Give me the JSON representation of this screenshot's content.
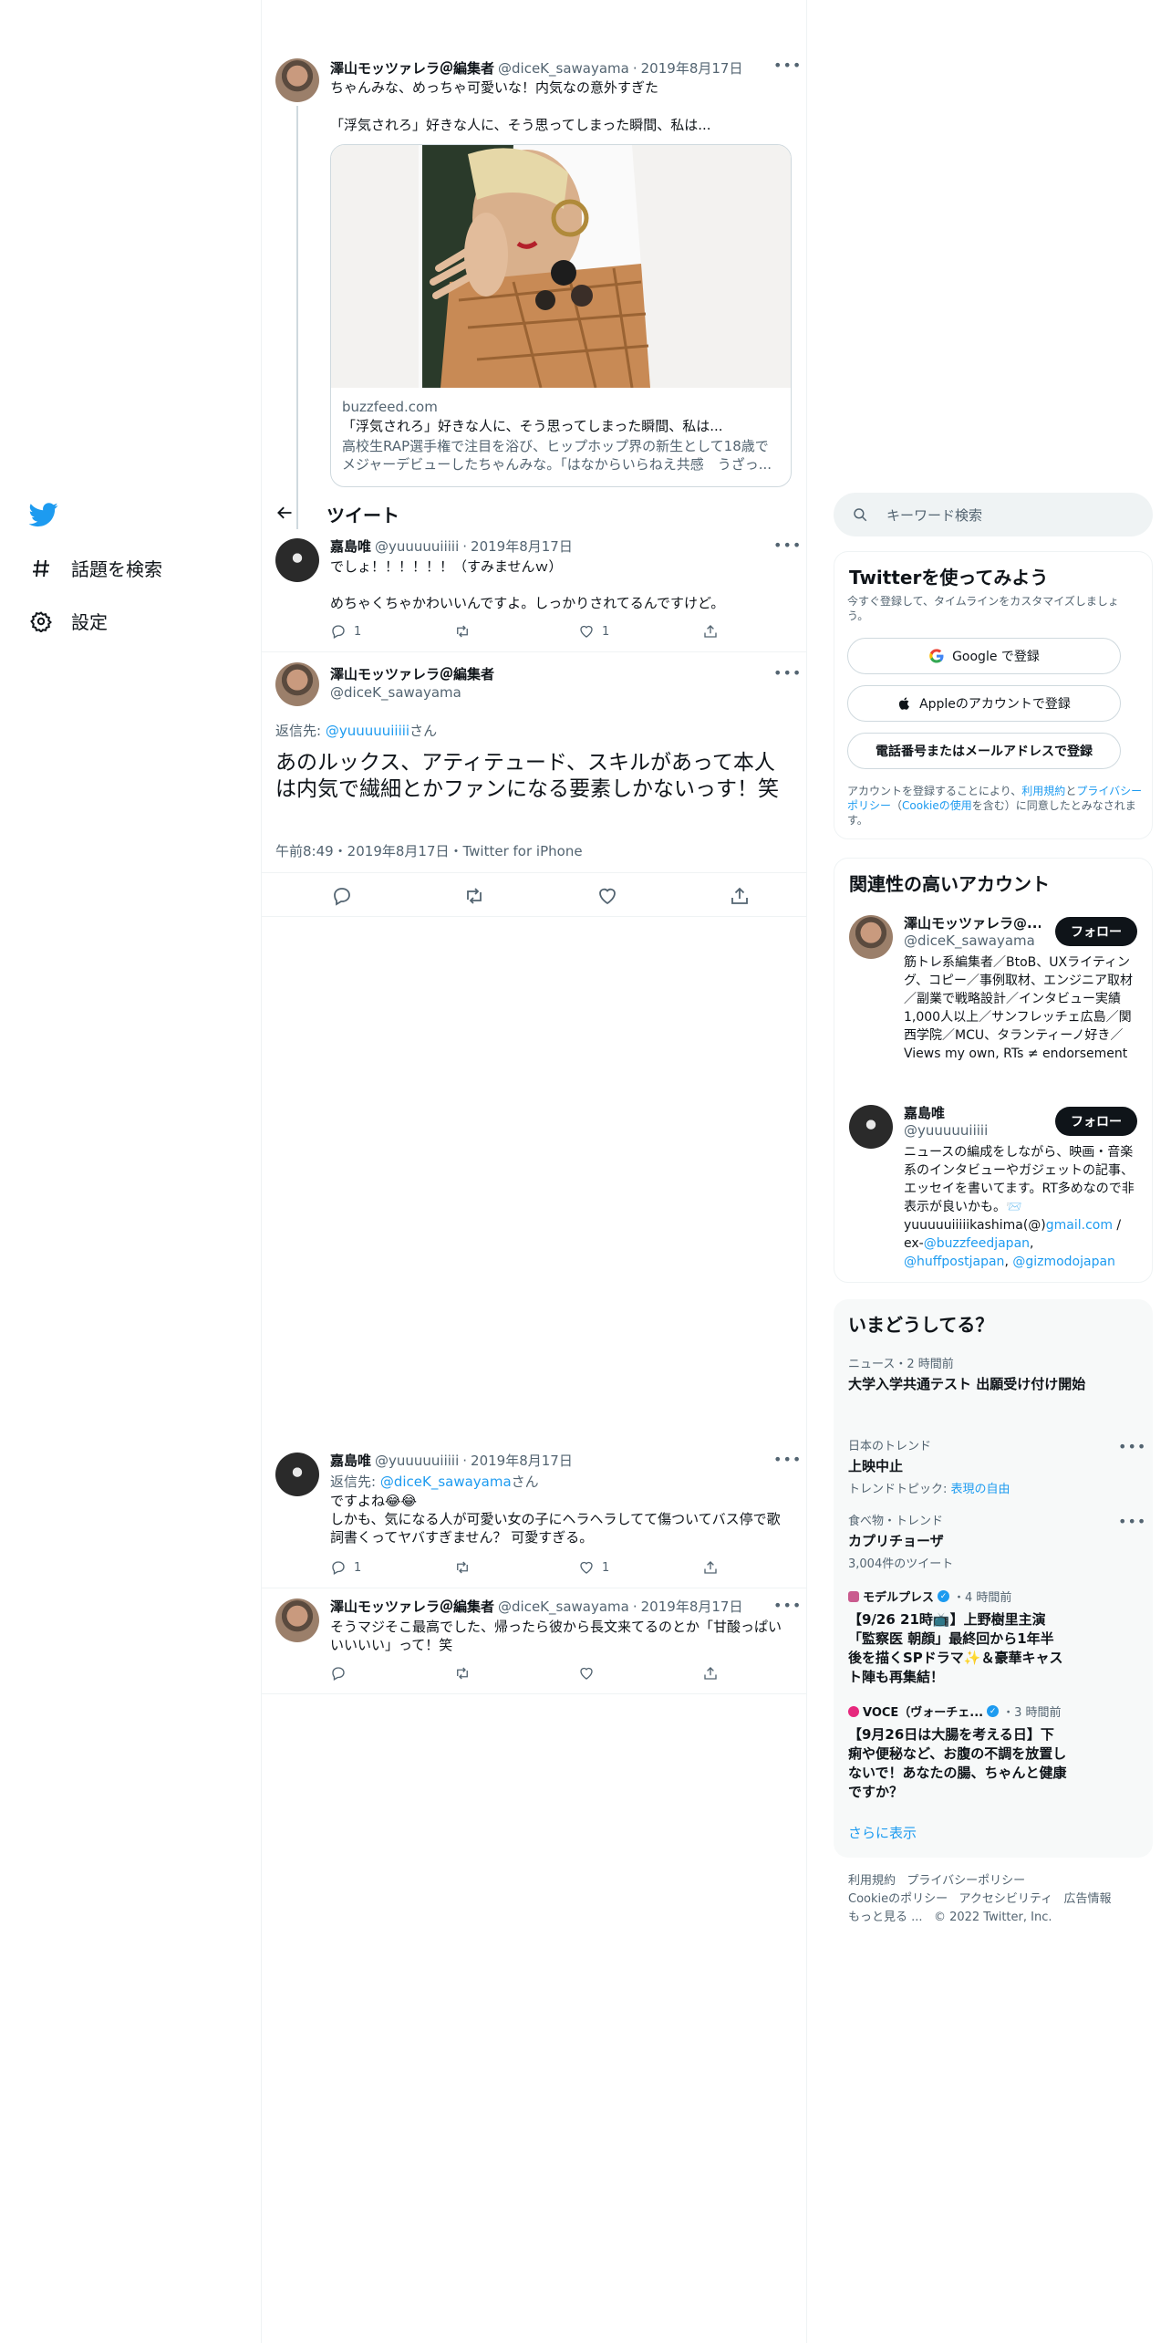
{
  "nav": {
    "logo_icon": "twitter-bird-icon",
    "explore_label": "話題を検索",
    "settings_label": "設定"
  },
  "quoted_tweet": {
    "author": "澤山モッツァレラ＠編集者",
    "handle": "@diceK_sawayama",
    "date": "2019年8月17日",
    "text": "ちゃんみな、めっちゃ可愛いな！内気なの意外すぎた",
    "text2": "「浮気されろ」好きな人に、そう思ってしまった瞬間、私は...",
    "card": {
      "domain": "buzzfeed.com",
      "title": "「浮気されろ」好きな人に、そう思ってしまった瞬間、私は...",
      "description": "高校生RAP選手権で注目を浴び、ヒップホップ界の新生として18歳でメジャーデビューしたちゃんみな。「はなからいらねえ共感　うざっ..."
    }
  },
  "header": {
    "back_icon": "back-arrow-icon",
    "title": "ツイート"
  },
  "reply1": {
    "author": "嘉島唯",
    "handle": "@yuuuuuiiiii",
    "date": "2019年8月17日",
    "text": "でしょ！！！！！！（すみませんｗ）\n\nめちゃくちゃかわいいんですよ。しっかりされてるんですけど。",
    "reply_count": "1",
    "like_count": "1"
  },
  "main_tweet": {
    "author": "澤山モッツァレラ＠編集者",
    "handle": "@diceK_sawayama",
    "reply_to_prefix": "返信先: ",
    "reply_to_handle": "@yuuuuuiiiii",
    "reply_to_suffix": "さん",
    "text": "あのルックス、アティテュード、スキルがあって本人は内気で繊細とかファンになる要素しかないっす！笑",
    "timestamp": "午前8:49・2019年8月17日・Twitter for iPhone"
  },
  "reply2": {
    "author": "嘉島唯",
    "handle": "@yuuuuuiiiii",
    "date": "2019年8月17日",
    "reply_to_prefix": "返信先: ",
    "reply_to_handle": "@diceK_sawayama",
    "reply_to_suffix": "さん",
    "text": "ですよね😂😂\nしかも、気になる人が可愛い女の子にヘラヘラしてて傷ついてバス停で歌詞書くってヤバすぎません？ 可愛すぎる。",
    "reply_count": "1",
    "like_count": "1"
  },
  "reply3": {
    "author": "澤山モッツァレラ＠編集者",
    "handle": "@diceK_sawayama",
    "date": "2019年8月17日",
    "text": "そうマジそこ最高でした、帰ったら彼から長文来てるのとか「甘酸っぱいいいいい」って！笑"
  },
  "search": {
    "placeholder": "キーワード検索"
  },
  "signup": {
    "title": "Twitterを使ってみよう",
    "subtitle": "今すぐ登録して、タイムラインをカスタマイズしましょう。",
    "google_label": "Google で登録",
    "apple_label": "Appleのアカウントで登録",
    "phone_label": "電話番号またはメールアドレスで登録",
    "terms_prefix": "アカウントを登録することにより、",
    "terms_link": "利用規約",
    "terms_and": "と",
    "privacy_link": "プライバシーポリシー",
    "cookie_open": "（",
    "cookie_link": "Cookieの使用",
    "terms_suffix": "を含む）に同意したとみなされます。"
  },
  "related": {
    "title": "関連性の高いアカウント",
    "accounts": [
      {
        "name": "澤山モッツァレラ@...",
        "handle": "@diceK_sawayama",
        "follow_label": "フォロー",
        "bio": "筋トレ系編集者／BtoB、UXライティング、コピー／事例取材、エンジニア取材／副業で戦略設計／インタビュー実績1,000人以上／サンフレッチェ広島／関西学院／MCU、タランティーノ好き／Views my own, RTs ≠ endorsement"
      },
      {
        "name": "嘉島唯",
        "handle": "@yuuuuuiiiii",
        "follow_label": "フォロー",
        "bio1": "ニュースの編成をしながら、映画・音楽系のインタビューやガジェットの記事、エッセイを書いてます。RT多めなので非表示が良いかも。📨 yuuuuuiiiiikashima(@)",
        "bio_link1": "gmail.com",
        "bio2": " / ex-",
        "bio_link2": "@buzzfeedjapan",
        "bio3": ", ",
        "bio_link3": "@huffpostjapan",
        "bio4": ", ",
        "bio_link4": "@gizmodojapan"
      }
    ]
  },
  "trends": {
    "title": "いまどうしてる？",
    "items": [
      {
        "meta": "ニュース・2 時間前",
        "title": "大学入学共通テスト 出願受け付け開始"
      },
      {
        "meta": "日本のトレンド",
        "title": "上映中止",
        "sub_prefix": "トレンドトピック: ",
        "sub_link": "表現の自由"
      },
      {
        "meta": "食べ物・トレンド",
        "title": "カプリチョーザ",
        "sub": "3,004件のツイート"
      },
      {
        "source": "モデルプレス",
        "time": "・4 時間前",
        "title": "【9/26 21時📺】上野樹里主演「監察医 朝顔」最終回から1年半後を描くSPドラマ✨＆豪華キャスト陣も再集結！"
      },
      {
        "source": "VOCE（ヴォーチェ...",
        "time": "・3 時間前",
        "title": "【9月26日は大腸を考える日】下痢や便秘など、お腹の不調を放置しないで！あなたの腸、ちゃんと健康ですか？"
      }
    ],
    "show_more": "さらに表示"
  },
  "footer": {
    "links": [
      "利用規約",
      "プライバシーポリシー",
      "Cookieのポリシー",
      "アクセシビリティ",
      "広告情報",
      "もっと見る ..."
    ],
    "copyright": "© 2022 Twitter, Inc."
  },
  "colors": {
    "accent": "#1d9bf0",
    "text": "#0f1419",
    "secondary": "#536471",
    "border": "#eff3f4"
  }
}
